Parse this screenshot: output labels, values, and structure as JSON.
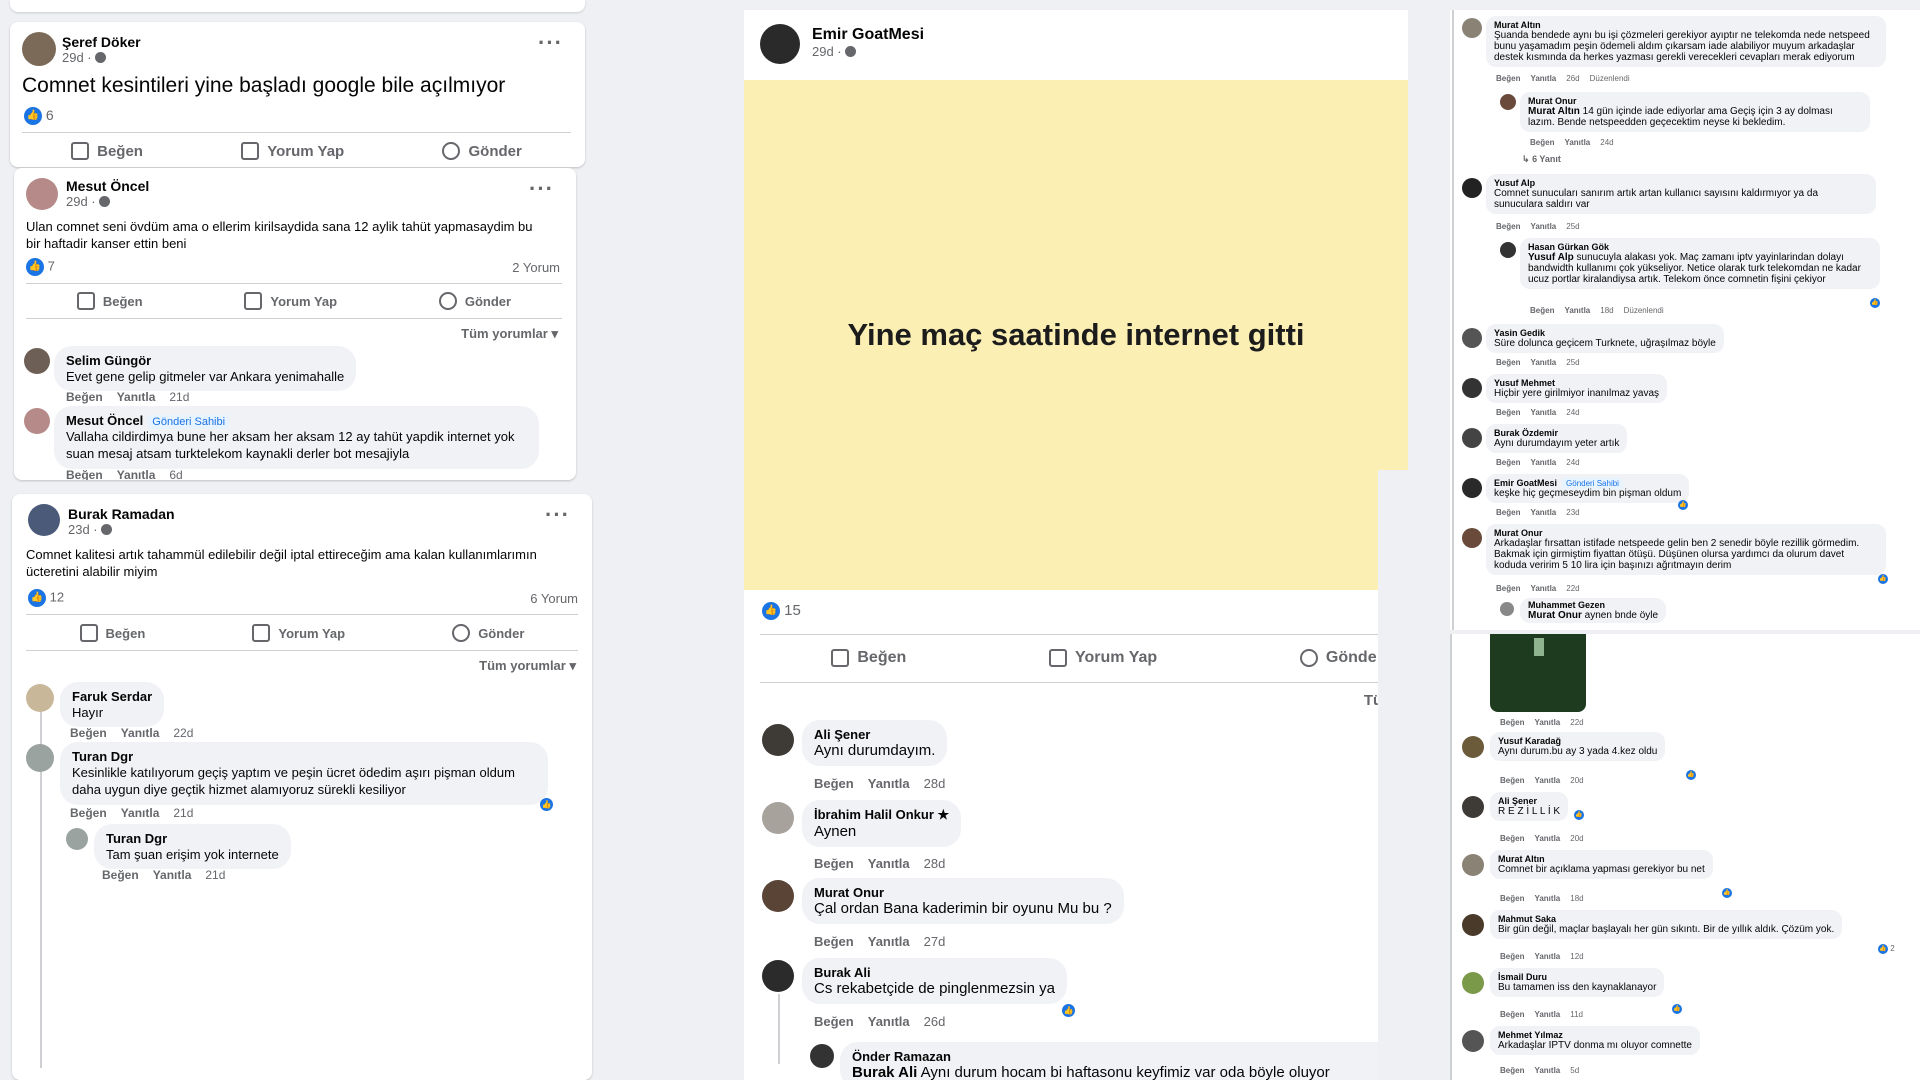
{
  "posts": [
    {
      "author": "Şeref Döker",
      "time": "29d ·",
      "text": "Comnet kesintileri yine başladı google bile açılmıyor",
      "likes": "6",
      "actions": [
        "Beğen",
        "Yorum Yap",
        "Gönder"
      ]
    },
    {
      "author": "Mesut Öncel",
      "time": "29d ·",
      "text": "Ulan comnet seni övdüm ama o ellerim kirilsaydida sana 12 aylik tahüt yapmasaydim bu bir haftadir kanser ettin beni",
      "likes": "7",
      "comment_count": "2 Yorum",
      "actions": [
        "Beğen",
        "Yorum Yap",
        "Gönder"
      ],
      "sort": "Tüm yorumlar",
      "comments": [
        {
          "name": "Selim Güngör",
          "text": "Evet gene gelip gitmeler var Ankara yenimahalle",
          "like": "Beğen",
          "reply": "Yanıtla",
          "time": "21d"
        },
        {
          "name": "Mesut Öncel",
          "badge": "Gönderi Sahibi",
          "text": "Vallaha cildirdimya bune her aksam her aksam 12 ay tahüt yapdik internet yok suan mesaj atsam turktelekom kaynakli derler bot mesajiyla",
          "like": "Beğen",
          "reply": "Yanıtla",
          "time": "6d"
        }
      ]
    },
    {
      "author": "Burak Ramadan",
      "time": "23d ·",
      "text": "Comnet kalitesi artık tahammül edilebilir değil iptal ettireceğim ama kalan kullanımlarımın ücteretini alabilir miyim",
      "likes": "12",
      "comment_count": "6 Yorum",
      "actions": [
        "Beğen",
        "Yorum Yap",
        "Gönder"
      ],
      "sort": "Tüm yorumlar",
      "comments": [
        {
          "name": "Faruk Serdar",
          "text": "Hayır",
          "like": "Beğen",
          "reply": "Yanıtla",
          "time": "22d"
        },
        {
          "name": "Turan Dgr",
          "text": "Kesinlikle katılıyorum geçiş yaptım ve peşin ücret ödedim aşırı pişman oldum daha uygun diye geçtik hizmet alamıyoruz sürekli kesiliyor",
          "like": "Beğen",
          "reply": "Yanıtla",
          "time": "21d"
        },
        {
          "name": "Turan Dgr",
          "text": "Tam şuan erişim yok internete",
          "like": "Beğen",
          "reply": "Yanıtla",
          "time": "21d"
        }
      ]
    },
    {
      "author": "Emir GoatMesi",
      "time": "29d ·",
      "image_text": "Yine maç saatinde internet gitti",
      "likes": "15",
      "actions": [
        "Beğen",
        "Yorum Yap",
        "Gönde"
      ],
      "sort": "Tüm y",
      "comments": [
        {
          "name": "Ali Şener",
          "text": "Aynı durumdayım.",
          "like": "Beğen",
          "reply": "Yanıtla",
          "time": "28d"
        },
        {
          "name": "İbrahim Halil Onkur",
          "text": "Aynen",
          "like": "Beğen",
          "reply": "Yanıtla",
          "time": "28d"
        },
        {
          "name": "Murat Onur",
          "text": "Çal ordan Bana kaderimin bir oyunu Mu bu ?",
          "like": "Beğen",
          "reply": "Yanıtla",
          "time": "27d"
        },
        {
          "name": "Burak Ali",
          "text": "Cs rekabetçide de pinglenmezsin ya",
          "like": "Beğen",
          "reply": "Yanıtla",
          "time": "26d"
        },
        {
          "name": "Önder Ramazan",
          "mention": "Burak Ali",
          "text": "Aynı durum hocam bi haftasonu keyfimiz var oda böyle oluyor",
          "like": "",
          "reply": "",
          "time": ""
        }
      ]
    }
  ],
  "right_thread_top": {
    "comments": [
      {
        "name": "Murat Altın",
        "text": "Şuanda bendede aynı bu işi çözmeleri gerekiyor ayıptır ne telekomda nede netspeed bunu yaşamadım peşin ödemeli aldım çıkarsam iade alabiliyor muyum arkadaşlar destek kısmında da herkes yazması gerekli verecekleri cevapları merak ediyorum",
        "like": "Beğen",
        "reply": "Yanıtla",
        "time": "26d",
        "extra": "Düzenlendi"
      },
      {
        "name": "Murat Onur",
        "mention": "Murat Altın",
        "text": "14 gün içinde iade ediyorlar ama Geçiş için 3 ay dolması lazım. Bende netspeedden geçecektim neyse ki bekledim.",
        "like": "Beğen",
        "reply": "Yanıtla",
        "time": "24d"
      },
      {
        "name": "Yusuf Alp",
        "text": "Comnet sunucuları sanırım artık artan kullanıcı sayısını kaldırmıyor ya da sunuculara saldırı var",
        "like": "Beğen",
        "reply": "Yanıtla",
        "time": "25d"
      },
      {
        "name": "Hasan Gürkan Gök",
        "mention": "Yusuf Alp",
        "text": "sunucuyla alakası yok. Maç zamanı iptv yayinlarindan dolayı bandwidth kullanımı çok yükseliyor. Netice olarak turk telekomdan ne kadar ucuz portlar kiralandiysa artık. Telekom önce comnetin fişini çekiyor",
        "like": "Beğen",
        "reply": "Yanıtla",
        "time": "18d",
        "extra": "Düzenlendi"
      },
      {
        "name": "Yasin Gedik",
        "text": "Süre dolunca geçicem Turknete, uğraşılmaz böyle",
        "like": "Beğen",
        "reply": "Yanıtla",
        "time": "25d"
      },
      {
        "name": "Yusuf Mehmet",
        "text": "Hiçbir yere girilmiyor inanılmaz yavaş",
        "like": "Beğen",
        "reply": "Yanıtla",
        "time": "24d"
      },
      {
        "name": "Burak Özdemir",
        "text": "Aynı durumdayım yeter artık",
        "like": "Beğen",
        "reply": "Yanıtla",
        "time": "24d"
      },
      {
        "name": "Emir GoatMesi",
        "badge": "Gönderi Sahibi",
        "text": "keşke hiç geçmeseydim bin pişman oldum",
        "like": "Beğen",
        "reply": "Yanıtla",
        "time": "23d"
      },
      {
        "name": "Murat Onur",
        "text": "Arkadaşlar fırsattan istifade netspeede gelin ben 2 senedir böyle rezillik görmedim. Bakmak için girmiştim fiyattan ötüşü. Düşünen olursa yardımcı da olurum davet koduda veririm 5 10 lira için başınızı ağrıtmayın derim",
        "like": "Beğen",
        "reply": "Yanıtla",
        "time": "22d"
      },
      {
        "name": "Muhammet Gezen",
        "mention": "Murat Onur",
        "text": "aynen bnde öyle",
        "like": "Beğen",
        "reply": "Yanıtla",
        "time": "21d"
      }
    ],
    "replies_link": "6 Yanıt"
  },
  "right_thread_bottom": {
    "image_meta": {
      "like": "Beğen",
      "reply": "Yanıtla",
      "time": "22d"
    },
    "comments": [
      {
        "name": "Yusuf Karadağ",
        "text": "Aynı durum.bu ay 3 yada 4.kez oldu",
        "like": "Beğen",
        "reply": "Yanıtla",
        "time": "20d"
      },
      {
        "name": "Ali Şener",
        "text": "R E Z İ L L İ K",
        "like": "Beğen",
        "reply": "Yanıtla",
        "time": "20d"
      },
      {
        "name": "Murat Altın",
        "text": "Comnet bir açıklama yapması gerekiyor bu net",
        "like": "Beğen",
        "reply": "Yanıtla",
        "time": "18d"
      },
      {
        "name": "Mahmut Saka",
        "text": "Bir gün değil, maçlar başlayalı her gün sıkıntı. Bir de yıllık aldık. Çözüm yok.",
        "reactions": "2",
        "like": "Beğen",
        "reply": "Yanıtla",
        "time": "12d"
      },
      {
        "name": "İsmail Duru",
        "text": "Bu tamamen iss den kaynaklanayor",
        "like": "Beğen",
        "reply": "Yanıtla",
        "time": "11d"
      },
      {
        "name": "Mehmet Yılmaz",
        "text": "Arkadaşlar IPTV donma mı oluyor comnette",
        "like": "Beğen",
        "reply": "Yanıtla",
        "time": "5d"
      }
    ]
  },
  "colors": {
    "accent": "#1b74e4",
    "image_bg": "#fbefb3",
    "bubble": "#f0f2f5",
    "muted": "#65676b"
  },
  "icons": [
    "like-icon",
    "comment-icon",
    "messenger-icon",
    "globe-icon",
    "more-icon",
    "star-icon",
    "reply-arrow-icon",
    "chevron-down-icon"
  ]
}
